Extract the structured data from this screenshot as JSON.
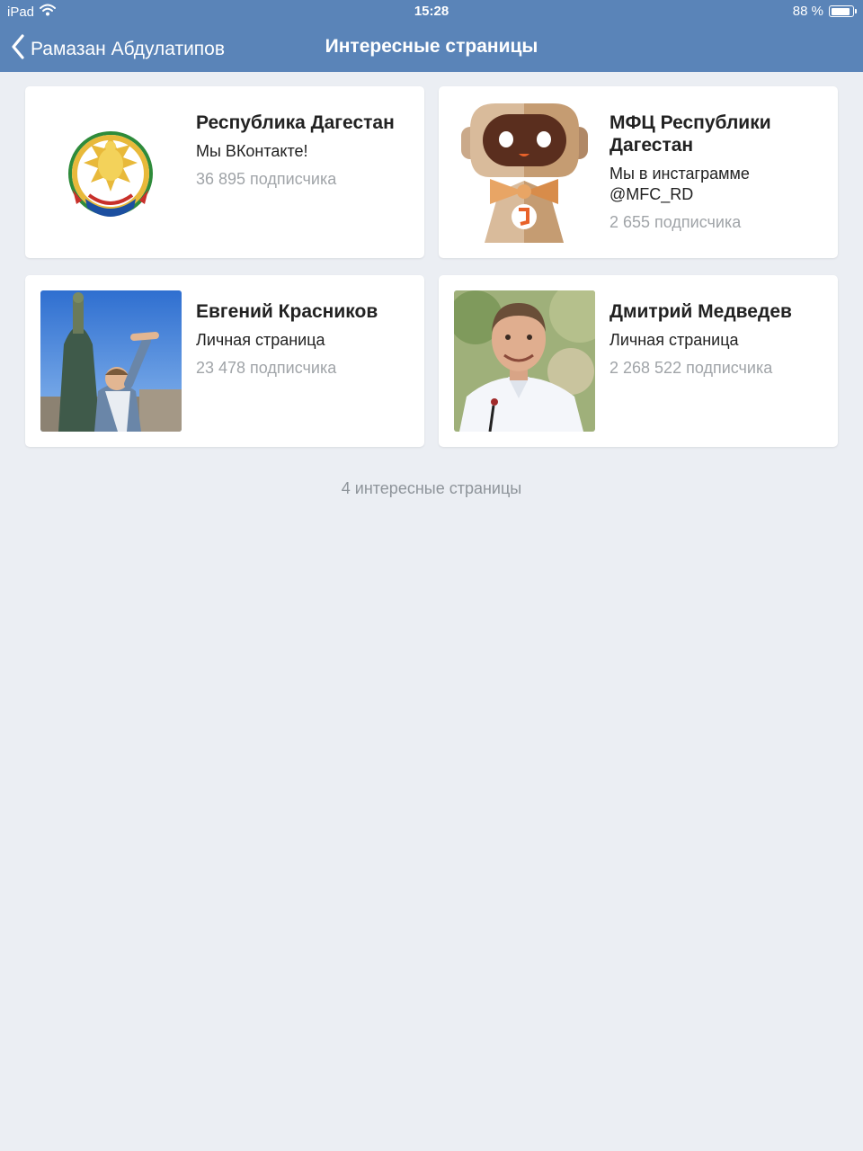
{
  "status_bar": {
    "device": "iPad",
    "time": "15:28",
    "battery": "88 %",
    "battery_level": 0.88
  },
  "nav": {
    "back_label": "Рамазан Абдулатипов",
    "title": "Интересные страницы"
  },
  "pages": [
    {
      "name": "Республика Дагестан",
      "status": "Мы ВКонтакте!",
      "subscribers": "36 895 подписчика",
      "avatar": "dagestan-emblem-icon"
    },
    {
      "name": "МФЦ Республики Дагестан",
      "status": "Мы в инстаграмме @MFC_RD",
      "subscribers": "2 655 подписчика",
      "avatar": "mfc-robot-mascot-icon"
    },
    {
      "name": "Евгений Красников",
      "status": "Личная страница",
      "subscribers": "23 478 подписчика",
      "avatar": "person-photo"
    },
    {
      "name": "Дмитрий Медведев",
      "status": "Личная страница",
      "subscribers": "2 268 522 подписчика",
      "avatar": "person-photo"
    }
  ],
  "footer": {
    "count_label": "4 интересные страницы"
  },
  "colors": {
    "header": "#5a84b8",
    "background": "#ebeef3",
    "card": "#ffffff",
    "muted_text": "#a0a4a8"
  }
}
